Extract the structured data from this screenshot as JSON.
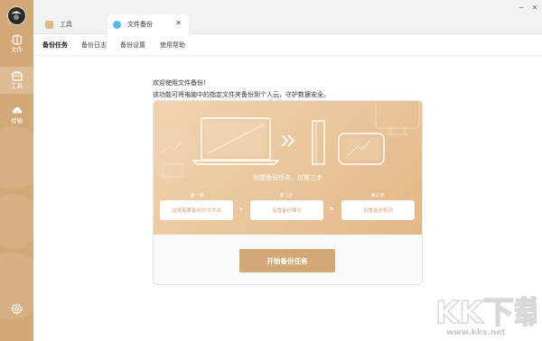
{
  "sidebar": {
    "items": [
      {
        "label": "文件",
        "icon": "file-icon",
        "active": false
      },
      {
        "label": "工具",
        "icon": "toolbox-icon",
        "active": true
      },
      {
        "label": "传输",
        "icon": "cloud-transfer-icon",
        "active": false
      }
    ],
    "settings_icon": "gear-icon"
  },
  "tabs": [
    {
      "label": "工具",
      "icon": "toolbox-icon",
      "active": false
    },
    {
      "label": "文件备份",
      "icon": "backup-icon",
      "active": true,
      "close": "✕"
    }
  ],
  "window_controls": {
    "minimize": "−",
    "close": "✕"
  },
  "submenu": [
    "备份任务",
    "备份日志",
    "备份设置",
    "使用帮助"
  ],
  "main": {
    "intro_line1": "欢迎使用文件备份！",
    "intro_line2": "该功能可将电脑中的指定文件夹备份到个人云，守护数据安全。",
    "banner_title": "创建备份任务，仅需三步",
    "steps": [
      {
        "label": "第一步",
        "text": "选择需要备份的文件夹"
      },
      {
        "label": "第二步",
        "text": "设置备份模式"
      },
      {
        "label": "第三步",
        "text": "设置备份规则"
      }
    ],
    "step_arrow": "»",
    "start_button": "开始备份任务"
  },
  "watermark": {
    "logo": "KK下载",
    "url": "www.kkx.net"
  },
  "colors": {
    "accent": "#d2a876",
    "sidebar": "#d2a878",
    "banner": "#ecc9a0"
  }
}
